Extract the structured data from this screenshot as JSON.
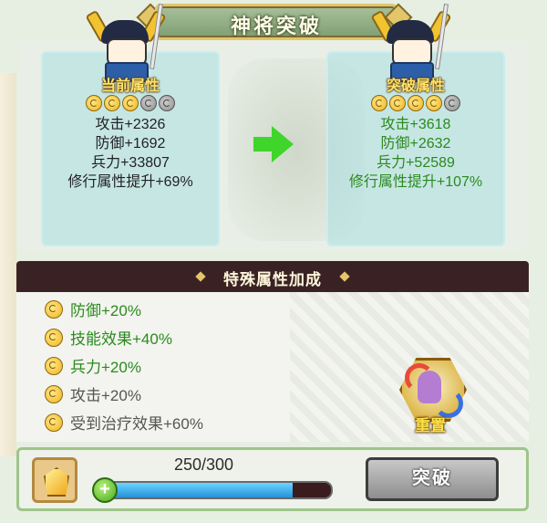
{
  "title": "神将突破",
  "current": {
    "header": "当前属性",
    "orbs": [
      true,
      true,
      true,
      false,
      false
    ],
    "stats": [
      "攻击+2326",
      "防御+1692",
      "兵力+33807",
      "修行属性提升+69%"
    ]
  },
  "next": {
    "header": "突破属性",
    "orbs": [
      true,
      true,
      true,
      true,
      false
    ],
    "stats": [
      "攻击+3618",
      "防御+2632",
      "兵力+52589",
      "修行属性提升+107%"
    ]
  },
  "bonus": {
    "header": "特殊属性加成",
    "items": [
      {
        "label": "防御+20%",
        "active": true,
        "color": "#2a8a1e"
      },
      {
        "label": "技能效果+40%",
        "active": true,
        "color": "#2a8a1e"
      },
      {
        "label": "兵力+20%",
        "active": true,
        "color": "#2a8a1e"
      },
      {
        "label": "攻击+20%",
        "active": true,
        "color": "#555555"
      },
      {
        "label": "受到治疗效果+60%",
        "active": true,
        "color": "#555555"
      }
    ],
    "reset_label": "重置"
  },
  "progress": {
    "text": "250/300",
    "value": 250,
    "max": 300
  },
  "break_button": "突破",
  "colors": {
    "accent_green": "#3fd52b",
    "stat_green": "#2a8a1e",
    "header_gold": "#ffe36b"
  }
}
